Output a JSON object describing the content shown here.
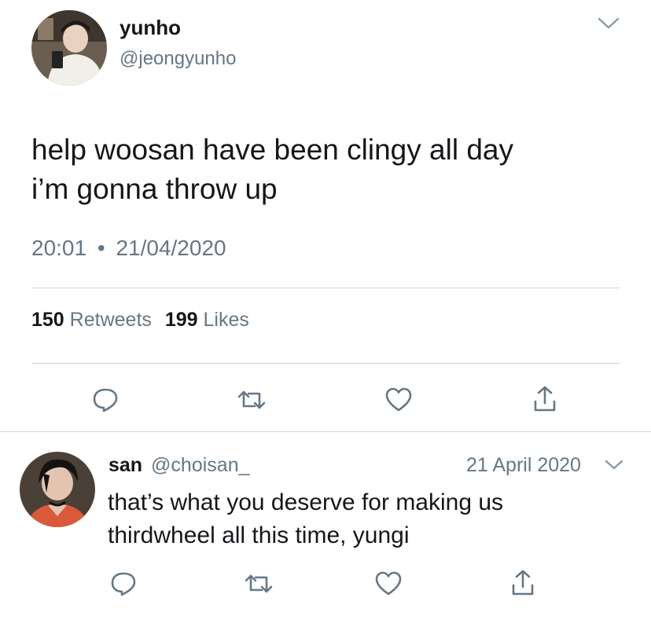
{
  "main_tweet": {
    "display_name": "yunho",
    "handle": "@jeongyunho",
    "text_line1": "help woosan have been clingy all day",
    "text_line2": "i’m gonna throw up",
    "time": "20:01",
    "separator": "•",
    "date": "21/04/2020",
    "retweets_count": "150",
    "retweets_label": "Retweets",
    "likes_count": "199",
    "likes_label": "Likes"
  },
  "reply": {
    "display_name": "san",
    "handle": "@choisan_",
    "date": "21 April 2020",
    "text_line1": "that’s what you deserve for making us",
    "text_line2": "thirdwheel all this time, yungi"
  },
  "icons": {
    "reply": "reply-icon",
    "retweet": "retweet-icon",
    "like": "heart-icon",
    "share": "share-icon",
    "more": "chevron-down-icon"
  },
  "colors": {
    "text": "#14171a",
    "muted": "#657786",
    "icon": "#657786",
    "divider": "#cfd6db"
  }
}
